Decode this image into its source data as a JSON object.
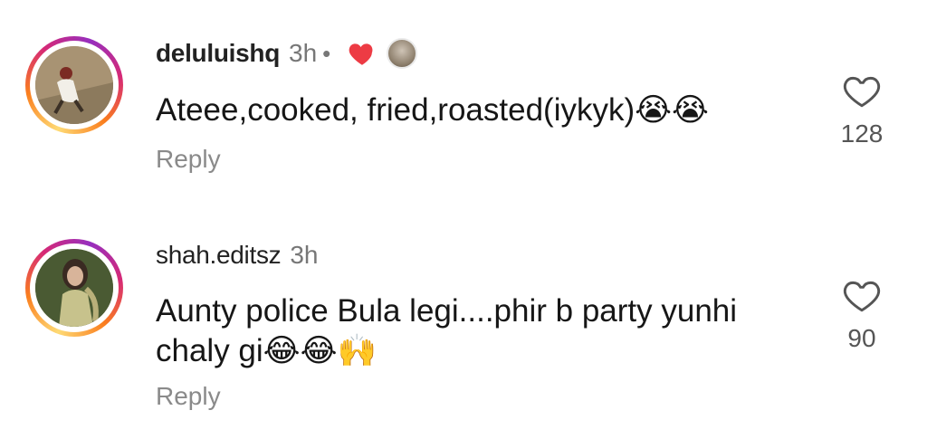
{
  "comments": [
    {
      "username": "deluluishq",
      "time": "3h",
      "separator": "•",
      "text": "Ateee,cooked, fried,roasted(iykyk)😭😭",
      "reply_label": "Reply",
      "like_count": "128",
      "creator_liked": true
    },
    {
      "username": "shah.editsz",
      "time": "3h",
      "text_line1": "Aunty police Bula legi....phir b party yunhi",
      "text_line2": "chaly gi😂😂🙌",
      "reply_label": "Reply",
      "like_count": "90"
    }
  ],
  "colors": {
    "liked_heart": "#ed3b44",
    "muted_text": "#8a8a8a",
    "ring_gradient": [
      "#feda75",
      "#fa7e1e",
      "#d62976",
      "#962fbf"
    ]
  },
  "icons": {
    "like": "heart-outline-icon",
    "creator_like": "heart-filled-icon"
  }
}
